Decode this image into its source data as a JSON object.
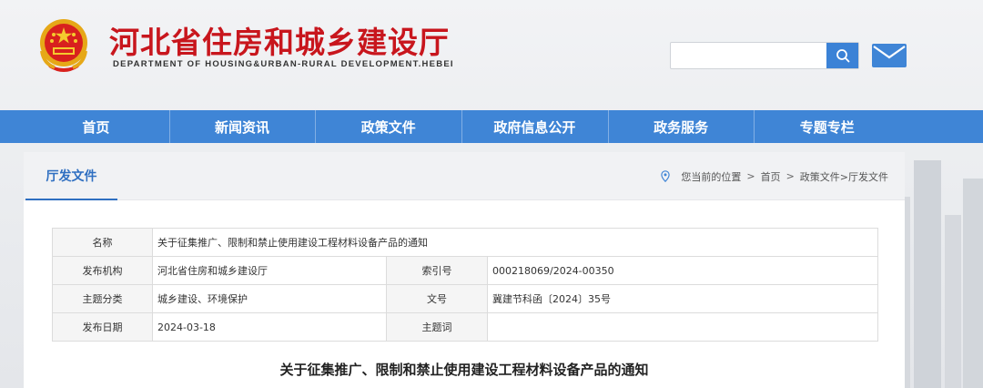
{
  "header": {
    "title": "河北省住房和城乡建设厅",
    "subtitle": "DEPARTMENT OF HOUSING&URBAN-RURAL DEVELOPMENT.HEBEI",
    "search": {
      "placeholder": "",
      "value": ""
    },
    "icons": {
      "search": "search-icon",
      "mail": "mail-icon",
      "emblem": "national-emblem"
    },
    "colors": {
      "title": "#c8161d",
      "nav": "#3f85d6",
      "accent": "#2f6fc1"
    }
  },
  "nav": {
    "items": [
      "首页",
      "新闻资讯",
      "政策文件",
      "政府信息公开",
      "政务服务",
      "专题专栏"
    ]
  },
  "section": {
    "tab": "厅发文件",
    "breadcrumb": {
      "prefix": "您当前的位置",
      "sep": ">",
      "home": "首页",
      "path": "政策文件>厅发文件"
    }
  },
  "info": {
    "name_label": "名称",
    "name_value": "关于征集推广、限制和禁止使用建设工程材料设备产品的通知",
    "org_label": "发布机构",
    "org_value": "河北省住房和城乡建设厅",
    "index_label": "索引号",
    "index_value": "000218069/2024-00350",
    "category_label": "主题分类",
    "category_value": "城乡建设、环境保护",
    "docno_label": "文号",
    "docno_value": "冀建节科函〔2024〕35号",
    "date_label": "发布日期",
    "date_value": "2024-03-18",
    "keyword_label": "主题词",
    "keyword_value": ""
  },
  "document": {
    "title": "关于征集推广、限制和禁止使用建设工程材料设备产品的通知"
  }
}
